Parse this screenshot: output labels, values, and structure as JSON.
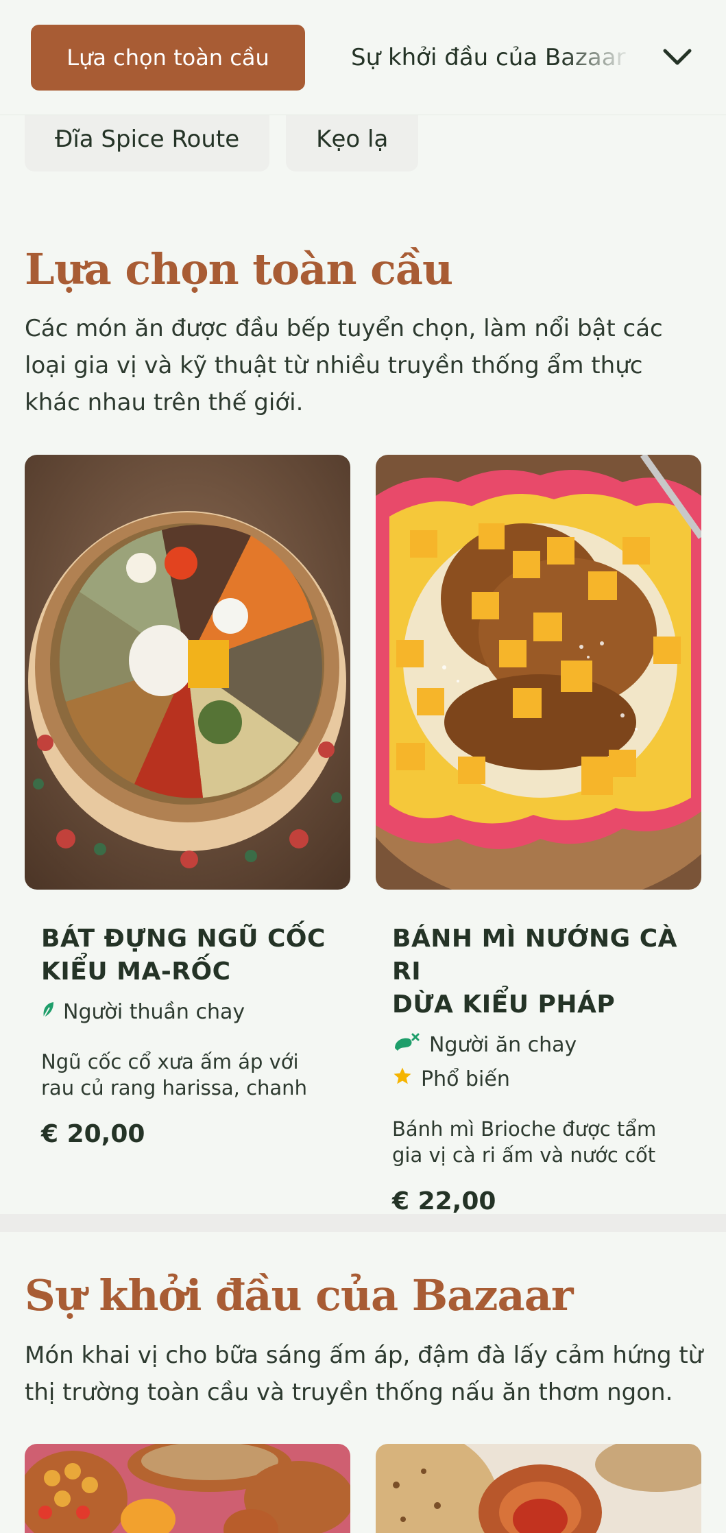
{
  "nav": {
    "active_category": "Lựa chọn toàn cầu",
    "next_category": "Sự khởi đầu của Bazaar",
    "subcategories": [
      "Đĩa Spice Route",
      "Kẹo lạ"
    ]
  },
  "section1": {
    "title": "Lựa chọn toàn cầu",
    "description": "Các món ăn được đầu bếp tuyển chọn, làm nổi bật các loại gia vị và kỹ thuật từ nhiều truyền thống ẩm thực khác nhau trên thế giới.",
    "items": [
      {
        "name_line1": "BÁT ĐỰNG NGŨ CỐC",
        "name_line2": "KIỂU MA-RỐC",
        "tags": [
          {
            "icon": "leaf-icon",
            "label": "Người thuần chay"
          }
        ],
        "description": "Ngũ cốc cổ xưa ấm áp với rau củ rang harissa, chanh muối...",
        "price": "€ 20,00"
      },
      {
        "name_line1": "BÁNH MÌ NƯỚNG CÀ RI",
        "name_line2": "DỪA KIỂU PHÁP",
        "tags": [
          {
            "icon": "no-meat-icon",
            "label": "Người ăn chay"
          },
          {
            "icon": "star-icon",
            "label": "Phổ biến"
          }
        ],
        "description": "Bánh mì Brioche được tẩm gia vị cà ri ấm và nước cốt dừa,...",
        "price": "€ 22,00"
      }
    ]
  },
  "section2": {
    "title": "Sự khởi đầu của Bazaar",
    "description": "Món khai vị cho bữa sáng ấm áp, đậm đà lấy cảm hứng từ thị trường toàn cầu và truyền thống nấu ăn thơm ngon."
  },
  "colors": {
    "accent": "#a85c34",
    "background": "#f4f7f3",
    "text": "#243326",
    "vegan_green": "#1e9e6a",
    "star_yellow": "#f5b400"
  }
}
